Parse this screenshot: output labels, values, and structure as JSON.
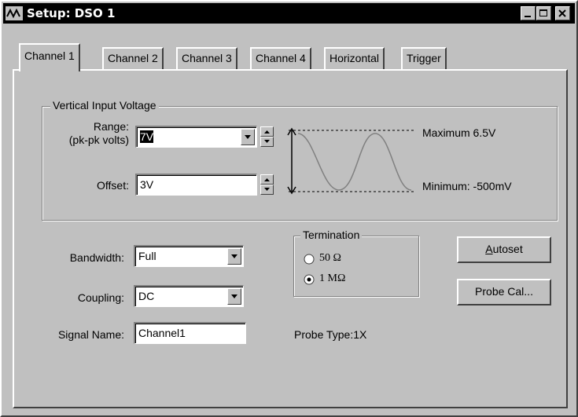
{
  "window": {
    "title": "Setup: DSO 1",
    "icon": "waveform-icon",
    "controls": [
      "minimize-icon",
      "maximize-icon",
      "close-icon"
    ]
  },
  "tabs": [
    {
      "label": "Channel 1",
      "active": true
    },
    {
      "label": "Channel 2",
      "active": false
    },
    {
      "label": "Channel 3",
      "active": false
    },
    {
      "label": "Channel 4",
      "active": false
    },
    {
      "label": "Horizontal",
      "active": false
    },
    {
      "label": "Trigger",
      "active": false
    }
  ],
  "vertical": {
    "group_label": "Vertical Input Voltage",
    "range_label": "Range:",
    "range_sublabel": "(pk-pk volts)",
    "range_value": "7V",
    "offset_label": "Offset:",
    "offset_value": "3V",
    "maximum_text": "Maximum  6.5V",
    "minimum_text": "Minimum:  -500mV"
  },
  "bandwidth": {
    "label": "Bandwidth:",
    "value": "Full"
  },
  "coupling": {
    "label": "Coupling:",
    "value": "DC"
  },
  "signal_name": {
    "label": "Signal Name:",
    "value": "Channel1"
  },
  "termination": {
    "group_label": "Termination",
    "options": [
      {
        "label": "50 Ω",
        "selected": false
      },
      {
        "label": "1 MΩ",
        "selected": true
      }
    ]
  },
  "probe_type": "Probe Type:1X",
  "buttons": {
    "autoset": "Autoset",
    "probe_cal": "Probe Cal..."
  },
  "colors": {
    "window_face": "#c0c0c0",
    "title_bar": "#000000",
    "wave": "#808080"
  }
}
